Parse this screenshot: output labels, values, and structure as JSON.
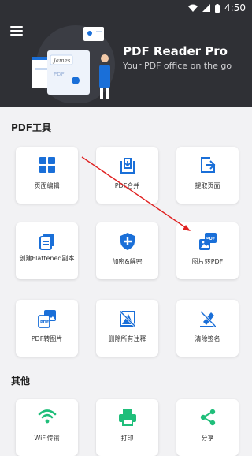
{
  "status": {
    "time": "4:50"
  },
  "header": {
    "title": "PDF Reader Pro",
    "subtitle": "Your PDF office on the go",
    "hero_signature": "James",
    "hero_doc_label": "PDF"
  },
  "sections": {
    "pdf_tools": "PDF工具",
    "other": "其他"
  },
  "tools": {
    "page_edit": "页面编辑",
    "pdf_merge": "PDF合并",
    "extract_pages": "提取页面",
    "flatten": "创建Flattened副本",
    "encrypt": "加密&解密",
    "image_to_pdf": "图片转PDF",
    "pdf_to_image": "PDF转图片",
    "delete_annotations": "删除所有注释",
    "clear_signature": "清除签名",
    "wifi": "WiFi传输",
    "print": "打印",
    "share": "分享",
    "pdf_badge": "PDF"
  },
  "colors": {
    "accent": "#1a6fd8",
    "green": "#1fbe7a",
    "header_bg": "#2f3035",
    "annotation_arrow": "#e02020"
  }
}
